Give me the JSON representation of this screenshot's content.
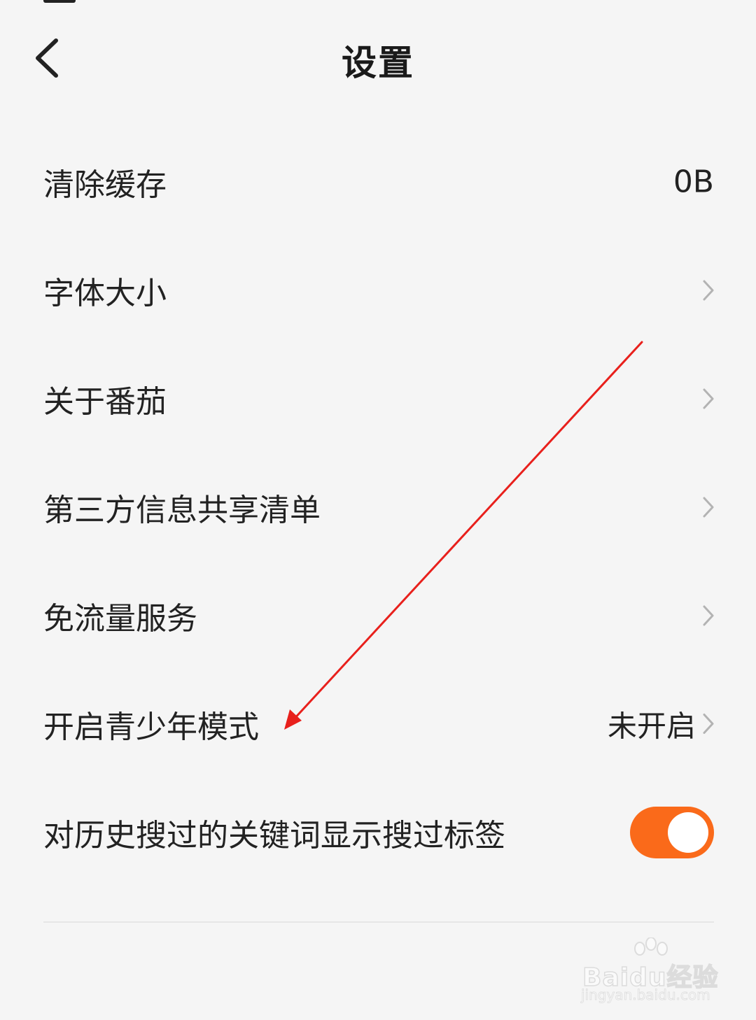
{
  "header": {
    "title": "设置",
    "back_icon": "chevron-left-icon"
  },
  "settings": [
    {
      "label": "清除缓存",
      "value": "0B",
      "has_chevron": false
    },
    {
      "label": "字体大小",
      "value": "",
      "has_chevron": true
    },
    {
      "label": "关于番茄",
      "value": "",
      "has_chevron": true
    },
    {
      "label": "第三方信息共享清单",
      "value": "",
      "has_chevron": true
    },
    {
      "label": "免流量服务",
      "value": "",
      "has_chevron": true
    },
    {
      "label": "开启青少年模式",
      "value": "未开启",
      "has_chevron": true
    },
    {
      "label": "对历史搜过的关键词显示搜过标签",
      "toggle_on": true
    }
  ],
  "watermark": {
    "brand": "Baidu经验",
    "url": "jingyan.baidu.com"
  },
  "colors": {
    "background": "#f5f5f5",
    "accent_toggle": "#fa6a1a",
    "annotation_arrow": "#e8201c",
    "chevron": "#b3b3b3"
  }
}
